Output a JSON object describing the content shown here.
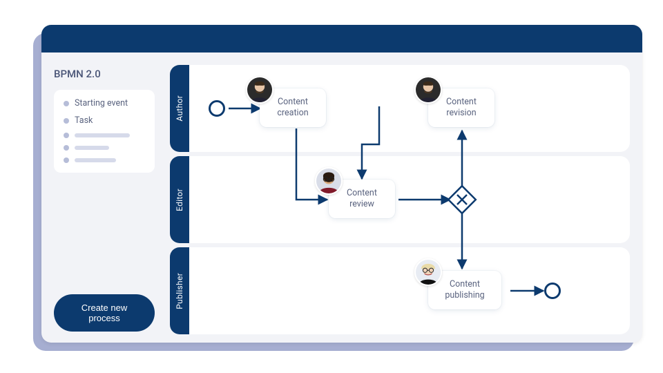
{
  "window": {
    "title_bar_color": "#0c3a6e"
  },
  "sidebar": {
    "title": "BPMN 2.0",
    "legend": {
      "items": [
        {
          "label": "Starting event"
        },
        {
          "label": "Task"
        }
      ]
    },
    "create_button": "Create new process"
  },
  "lanes": [
    {
      "id": "author",
      "label": "Author"
    },
    {
      "id": "editor",
      "label": "Editor"
    },
    {
      "id": "publisher",
      "label": "Publisher"
    }
  ],
  "tasks": {
    "creation": {
      "label_line1": "Content",
      "label_line2": "creation"
    },
    "revision": {
      "label_line1": "Content",
      "label_line2": "revision"
    },
    "review": {
      "label_line1": "Content",
      "label_line2": "review"
    },
    "publishing": {
      "label_line1": "Content",
      "label_line2": "publishing"
    }
  },
  "colors": {
    "primary": "#0c3a6e",
    "surface": "#f2f3f7",
    "muted": "#b6bdd8",
    "text": "#5a637f"
  }
}
